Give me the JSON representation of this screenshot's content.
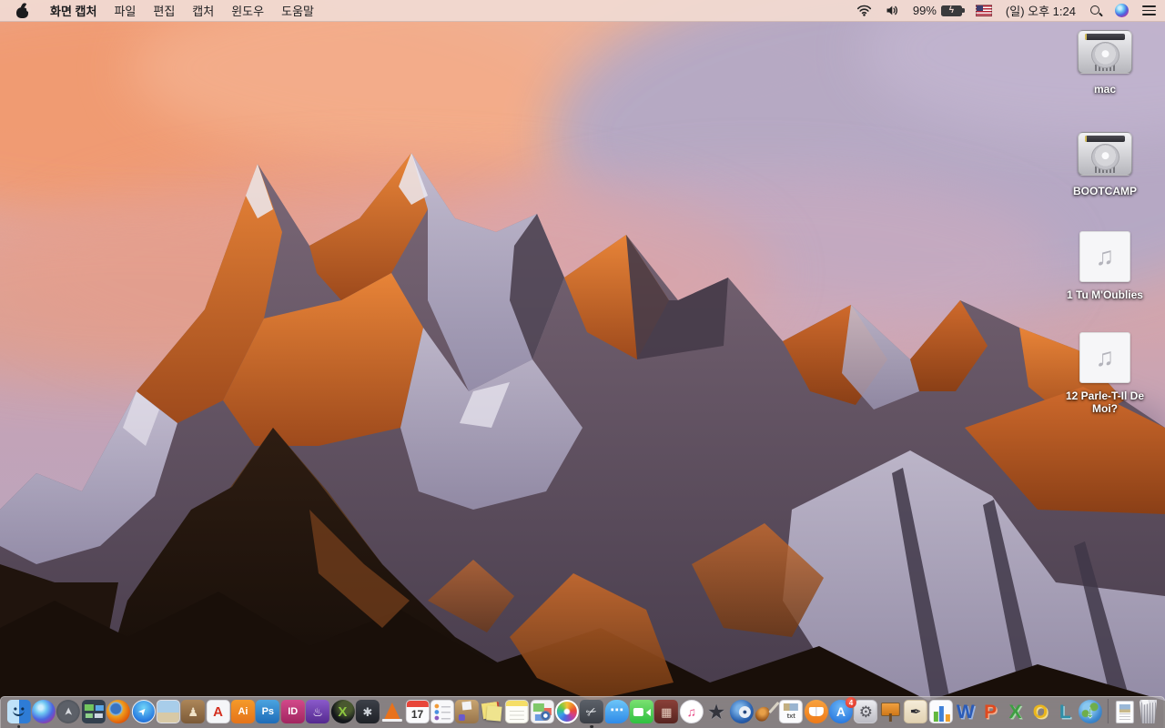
{
  "menu_bar": {
    "apple_icon": "apple-logo",
    "app_name": "화면 캡처",
    "menus": [
      {
        "id": "file",
        "label": "파일"
      },
      {
        "id": "edit",
        "label": "편집"
      },
      {
        "id": "capture",
        "label": "캡처"
      },
      {
        "id": "window",
        "label": "윈도우"
      },
      {
        "id": "help",
        "label": "도움말"
      }
    ],
    "status": {
      "icons": [
        "wifi-icon",
        "volume-icon",
        "battery-charging-icon",
        "input-source-us-flag-icon",
        "spotlight-search-icon",
        "siri-icon",
        "notification-center-icon"
      ],
      "battery_percent": "99%",
      "battery_bolt_glyph": "ϟ",
      "clock": "(일) 오후 1:24"
    }
  },
  "desktop": {
    "wallpaper_description": "macOS Sierra default wallpaper — Lone Pine Peak at sunset, orange-lit snowy mountain under pink and lavender clouds, dark rocky foreground",
    "icons": [
      {
        "id": "mac",
        "type": "hard-drive",
        "icon": "hard-drive-icon",
        "label": "mac"
      },
      {
        "id": "bootcamp",
        "type": "hard-drive",
        "icon": "hard-drive-icon",
        "label": "BOOTCAMP"
      },
      {
        "id": "audio1",
        "type": "audio-file",
        "icon": "music-note-file-icon",
        "glyph": "♫",
        "label": "1 Tu M'Oublies"
      },
      {
        "id": "audio2",
        "type": "audio-file",
        "icon": "music-note-file-icon",
        "glyph": "♫",
        "label": "12 Parle-T-Il De Moi?"
      }
    ]
  },
  "dock": {
    "items": [
      {
        "id": "finder",
        "icon": "finder-icon",
        "running": true
      },
      {
        "id": "siri",
        "icon": "siri-icon"
      },
      {
        "id": "launchpad",
        "icon": "launchpad-rocket-icon",
        "glyph": "➤"
      },
      {
        "id": "mission-control",
        "icon": "mission-control-windows-icon"
      },
      {
        "id": "firefox",
        "icon": "firefox-icon"
      },
      {
        "id": "safari",
        "icon": "safari-compass-icon",
        "glyph": "➤"
      },
      {
        "id": "preview",
        "icon": "preview-photo-icon"
      },
      {
        "id": "contacts",
        "icon": "contacts-book-icon",
        "glyph": "♟"
      },
      {
        "id": "acrobat",
        "icon": "adobe-acrobat-icon",
        "glyph": "A"
      },
      {
        "id": "illustrator",
        "icon": "adobe-illustrator-icon",
        "glyph": "Ai"
      },
      {
        "id": "photoshop",
        "icon": "adobe-photoshop-icon",
        "glyph": "Ps"
      },
      {
        "id": "indesign",
        "icon": "adobe-indesign-icon",
        "glyph": "ID"
      },
      {
        "id": "toast",
        "icon": "purple-toaster-burner-icon",
        "glyph": "♨"
      },
      {
        "id": "xee",
        "icon": "green-x-image-viewer-icon",
        "glyph": "X"
      },
      {
        "id": "disktool",
        "icon": "black-drive-fan-icon",
        "glyph": "✱"
      },
      {
        "id": "vlc",
        "icon": "vlc-traffic-cone-icon"
      },
      {
        "id": "calendar",
        "icon": "calendar-icon",
        "glyph": "17"
      },
      {
        "id": "reminders",
        "icon": "reminders-list-icon"
      },
      {
        "id": "stuffit",
        "icon": "stuffit-expander-box-icon"
      },
      {
        "id": "stickies",
        "icon": "stickies-yellow-notes-icon"
      },
      {
        "id": "notes",
        "icon": "notes-icon"
      },
      {
        "id": "maps",
        "icon": "colorful-cards-compass-icon"
      },
      {
        "id": "photos",
        "icon": "photos-pinwheel-icon"
      },
      {
        "id": "grab",
        "icon": "grab-scissors-icon",
        "glyph": "✂",
        "running": true
      },
      {
        "id": "messages",
        "icon": "messages-speech-bubble-icon",
        "glyph": "⋯"
      },
      {
        "id": "facetime",
        "icon": "facetime-video-camera-icon"
      },
      {
        "id": "booth",
        "icon": "photo-booth-icon",
        "glyph": "▦"
      },
      {
        "id": "itunes",
        "icon": "itunes-music-note-icon",
        "glyph": "♫"
      },
      {
        "id": "imovie",
        "icon": "imovie-star-icon",
        "glyph": "★"
      },
      {
        "id": "dvd",
        "icon": "blue-disc-app-icon"
      },
      {
        "id": "garage",
        "icon": "garageband-guitar-icon"
      },
      {
        "id": "textdocs",
        "icon": "txt-documents-stack-icon",
        "glyph": "txt"
      },
      {
        "id": "ibooks",
        "icon": "ibooks-open-book-icon"
      },
      {
        "id": "appstore",
        "icon": "app-store-icon",
        "glyph": "A",
        "badge": "4"
      },
      {
        "id": "sysprefs",
        "icon": "system-preferences-gear-icon",
        "glyph": "⚙"
      },
      {
        "id": "keynote",
        "icon": "keynote-lectern-icon"
      },
      {
        "id": "pages",
        "icon": "pages-ink-pen-icon",
        "glyph": "✒"
      },
      {
        "id": "numbers",
        "icon": "numbers-bar-chart-icon"
      },
      {
        "id": "word",
        "icon": "ms-word-w-icon",
        "glyph": "W"
      },
      {
        "id": "powerpoint",
        "icon": "ms-powerpoint-p-icon",
        "glyph": "P"
      },
      {
        "id": "excel",
        "icon": "ms-excel-x-icon",
        "glyph": "X"
      },
      {
        "id": "outlook",
        "icon": "ms-outlook-o-icon",
        "glyph": "O"
      },
      {
        "id": "lync",
        "icon": "ms-lync-l-icon",
        "glyph": "L"
      },
      {
        "id": "msglobe",
        "icon": "globe-download-icon",
        "glyph": "↓"
      },
      {
        "id": "divider",
        "type": "divider",
        "icon": "dock-divider"
      },
      {
        "id": "docfile",
        "type": "file",
        "icon": "document-file-icon"
      },
      {
        "id": "trash",
        "type": "trash",
        "icon": "trash-full-icon"
      }
    ]
  },
  "colors": {
    "menubar_bg": "#f0d8d0",
    "menubar_text": "#1d1d1f",
    "dock_bg": "rgba(226,223,230,0.55)",
    "badge_red": "#d6281c",
    "sky_pink": "#e4ae9d",
    "sky_lavender": "#b2a6c2",
    "rock_orange": "#d06c2c",
    "foreground_dark": "#1a100a"
  }
}
